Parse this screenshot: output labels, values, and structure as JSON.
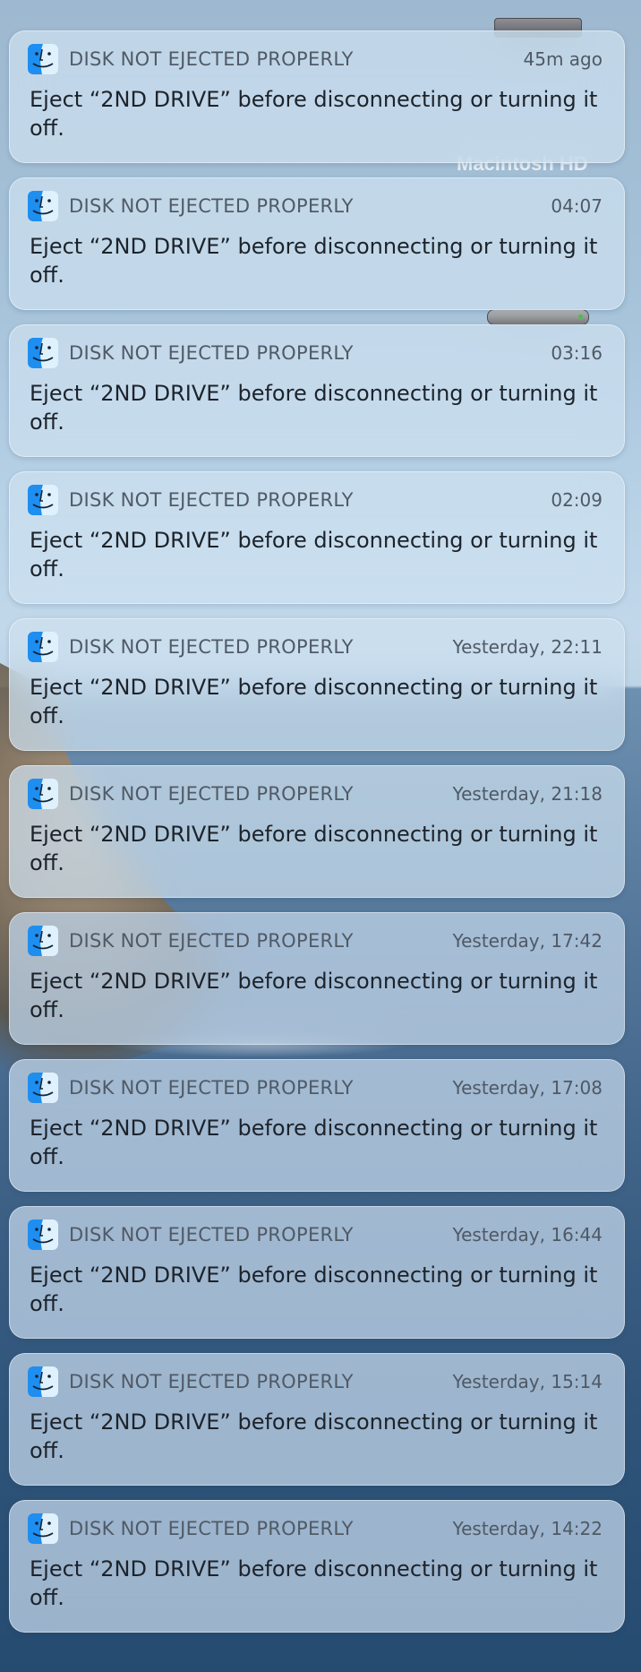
{
  "notifications": [
    {
      "app_icon": "finder-icon",
      "title": "DISK NOT EJECTED PROPERLY",
      "time": "45m ago",
      "body": "Eject “2ND DRIVE” before disconnecting or turning it off."
    },
    {
      "app_icon": "finder-icon",
      "title": "DISK NOT EJECTED PROPERLY",
      "time": "04:07",
      "body": "Eject “2ND DRIVE” before disconnecting or turning it off."
    },
    {
      "app_icon": "finder-icon",
      "title": "DISK NOT EJECTED PROPERLY",
      "time": "03:16",
      "body": "Eject “2ND DRIVE” before disconnecting or turning it off."
    },
    {
      "app_icon": "finder-icon",
      "title": "DISK NOT EJECTED PROPERLY",
      "time": "02:09",
      "body": "Eject “2ND DRIVE” before disconnecting or turning it off."
    },
    {
      "app_icon": "finder-icon",
      "title": "DISK NOT EJECTED PROPERLY",
      "time": "Yesterday, 22:11",
      "body": "Eject “2ND DRIVE” before disconnecting or turning it off."
    },
    {
      "app_icon": "finder-icon",
      "title": "DISK NOT EJECTED PROPERLY",
      "time": "Yesterday, 21:18",
      "body": "Eject “2ND DRIVE” before disconnecting or turning it off."
    },
    {
      "app_icon": "finder-icon",
      "title": "DISK NOT EJECTED PROPERLY",
      "time": "Yesterday, 17:42",
      "body": "Eject “2ND DRIVE” before disconnecting or turning it off."
    },
    {
      "app_icon": "finder-icon",
      "title": "DISK NOT EJECTED PROPERLY",
      "time": "Yesterday, 17:08",
      "body": "Eject “2ND DRIVE” before disconnecting or turning it off."
    },
    {
      "app_icon": "finder-icon",
      "title": "DISK NOT EJECTED PROPERLY",
      "time": "Yesterday, 16:44",
      "body": "Eject “2ND DRIVE” before disconnecting or turning it off."
    },
    {
      "app_icon": "finder-icon",
      "title": "DISK NOT EJECTED PROPERLY",
      "time": "Yesterday, 15:14",
      "body": "Eject “2ND DRIVE” before disconnecting or turning it off."
    },
    {
      "app_icon": "finder-icon",
      "title": "DISK NOT EJECTED PROPERLY",
      "time": "Yesterday, 14:22",
      "body": "Eject “2ND DRIVE” before disconnecting or turning it off."
    }
  ],
  "desktop": {
    "drive_label": "Macintosh HD",
    "colors": {
      "sky": "#b7d1e6",
      "ocean": "#3f6287",
      "finder_blue": "#1e8ef0",
      "finder_light": "#8fd0fb"
    }
  }
}
